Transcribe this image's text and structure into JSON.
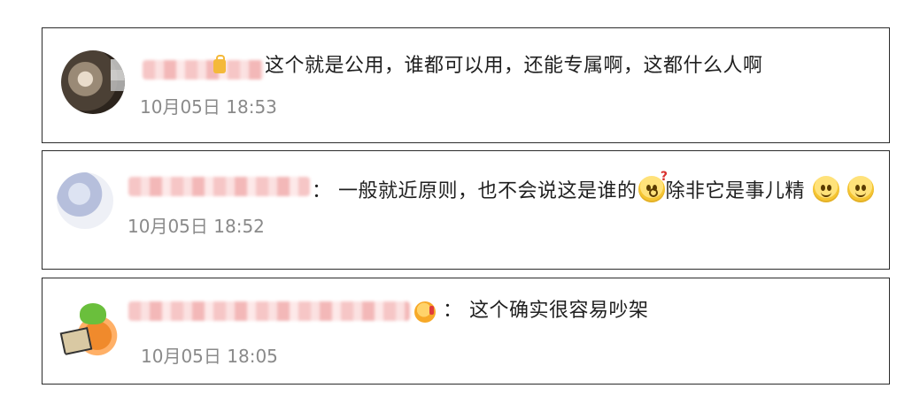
{
  "comments": [
    {
      "separator": "",
      "text_parts": [
        "这个就是公用，谁都可以用，还能专属啊，这都什么人啊"
      ],
      "timestamp": "10月05日 18:53",
      "badge_icon": "lock-badge-icon"
    },
    {
      "separator": "：",
      "text_parts": [
        "一般就近原则，也不会说这是谁的",
        "除非它是事儿精"
      ],
      "emojis": [
        "thinking-question-emoji-icon",
        "smiley-emoji-icon",
        "smiley-emoji-icon"
      ],
      "timestamp": "10月05日 18:52"
    },
    {
      "separator": "：",
      "text_parts": [
        "这个确实很容易吵架"
      ],
      "timestamp": "10月05日 18:05",
      "badge_icon": "vip-medal-icon"
    }
  ],
  "colors": {
    "border": "#2b2b2b",
    "text": "#1f1f1f",
    "timestamp": "#8a8a8a",
    "emoji_yellow": "#ffe27a"
  }
}
